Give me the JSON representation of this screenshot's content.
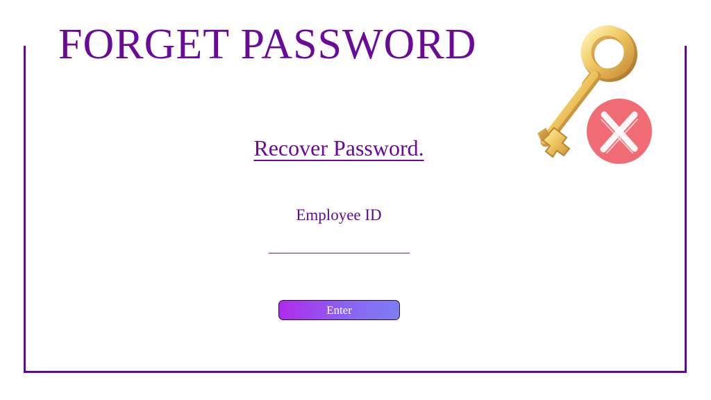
{
  "header": {
    "title": "FORGET PASSWORD"
  },
  "form": {
    "heading": "Recover Password.",
    "employee_id_label": "Employee ID",
    "employee_id_value": "",
    "employee_id_placeholder": "",
    "enter_label": "Enter"
  },
  "icons": {
    "logo": "key-with-cancel-icon"
  },
  "colors": {
    "accent": "#6a0a99",
    "frame": "#5e0a93",
    "button_gradient_start": "#b02bea",
    "button_gradient_end": "#7f7df3",
    "cancel_badge": "#f06b74"
  }
}
